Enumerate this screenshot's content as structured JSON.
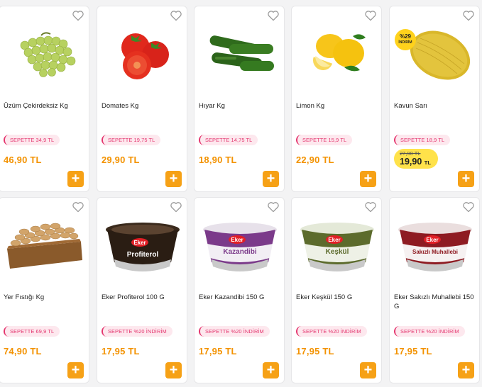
{
  "products": [
    {
      "name": "Üzüm Çekirdeksiz Kg",
      "sepette": "SEPETTE 34,9 TL",
      "price": "46,90 TL",
      "image": "grapes"
    },
    {
      "name": "Domates Kg",
      "sepette": "SEPETTE 19,75 TL",
      "price": "29,90 TL",
      "image": "tomatoes"
    },
    {
      "name": "Hıyar Kg",
      "sepette": "SEPETTE 14,75 TL",
      "price": "18,90 TL",
      "image": "cucumbers"
    },
    {
      "name": "Limon Kg",
      "sepette": "SEPETTE 15,9 TL",
      "price": "22,90 TL",
      "image": "lemons"
    },
    {
      "name": "Kavun Sarı",
      "sepette": "SEPETTE 18,9 TL",
      "old_price": "27,90 TL",
      "price": "19,90",
      "price_unit": "TL",
      "discount": "%29",
      "discount_label": "İNDİRİM",
      "image": "melon"
    },
    {
      "name": "Yer Fıstığı Kg",
      "sepette": "SEPETTE 69,9 TL",
      "price": "74,90 TL",
      "image": "peanuts"
    },
    {
      "name": "Eker Profiterol 100 G",
      "sepette": "SEPETTE %20 İNDİRİM",
      "price": "17,95 TL",
      "image": "cup",
      "cup_text": "Profiterol",
      "brand": "Eker"
    },
    {
      "name": "Eker Kazandibi 150 G",
      "sepette": "SEPETTE %20 İNDİRİM",
      "price": "17,95 TL",
      "image": "cup",
      "cup_text": "Kazandibi",
      "brand": "Eker"
    },
    {
      "name": "Eker Keşkül 150 G",
      "sepette": "SEPETTE %20 İNDİRİM",
      "price": "17,95 TL",
      "image": "cup",
      "cup_text": "Keşkül",
      "brand": "Eker"
    },
    {
      "name": "Eker Sakızlı Muhallebi 150 G",
      "sepette": "SEPETTE %20 İNDİRİM",
      "price": "17,95 TL",
      "image": "cup",
      "cup_text": "Sakızlı Muhallebi",
      "brand": "Eker"
    }
  ],
  "add_label": "+",
  "colors": {
    "accent": "#f39200",
    "sepette": "#e4356e",
    "promo": "#ffe24a"
  }
}
